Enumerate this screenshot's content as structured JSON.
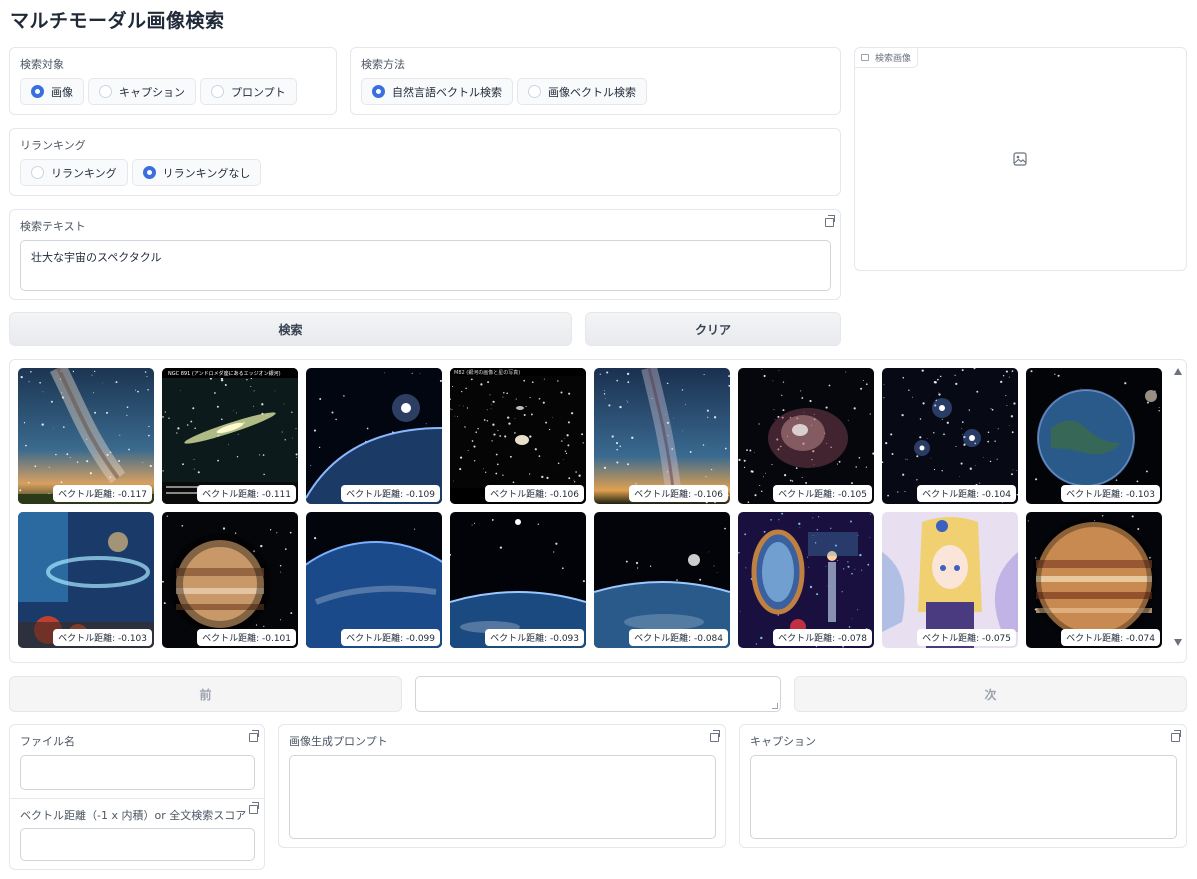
{
  "app": {
    "title": "マルチモーダル画像検索"
  },
  "target": {
    "label": "検索対象",
    "options": [
      {
        "label": "画像",
        "selected": true
      },
      {
        "label": "キャプション",
        "selected": false
      },
      {
        "label": "プロンプト",
        "selected": false
      }
    ]
  },
  "method": {
    "label": "検索方法",
    "options": [
      {
        "label": "自然言語ベクトル検索",
        "selected": true
      },
      {
        "label": "画像ベクトル検索",
        "selected": false
      }
    ]
  },
  "rerank": {
    "label": "リランキング",
    "options": [
      {
        "label": "リランキング",
        "selected": false
      },
      {
        "label": "リランキングなし",
        "selected": true
      }
    ]
  },
  "query": {
    "label": "検索テキスト",
    "value": "壮大な宇宙のスペクタクル"
  },
  "image_input": {
    "label": "検索画像"
  },
  "buttons": {
    "search": "検索",
    "clear": "クリア",
    "prev": "前",
    "next": "次"
  },
  "gallery": {
    "caption_prefix": "ベクトル距離:",
    "items": [
      {
        "score": "-0.117",
        "art": "milkyway"
      },
      {
        "score": "-0.111",
        "art": "galaxy_edge"
      },
      {
        "score": "-0.109",
        "art": "planet_rise"
      },
      {
        "score": "-0.106",
        "art": "starfield"
      },
      {
        "score": "-0.106",
        "art": "milkyway2"
      },
      {
        "score": "-0.105",
        "art": "nebula"
      },
      {
        "score": "-0.104",
        "art": "cluster"
      },
      {
        "score": "-0.103",
        "art": "earth_globe"
      },
      {
        "score": "-0.103",
        "art": "fantasy_book"
      },
      {
        "score": "-0.101",
        "art": "jupiter"
      },
      {
        "score": "-0.099",
        "art": "earth_night"
      },
      {
        "score": "-0.093",
        "art": "earth_limb"
      },
      {
        "score": "-0.084",
        "art": "earth_moon"
      },
      {
        "score": "-0.078",
        "art": "mirror"
      },
      {
        "score": "-0.075",
        "art": "fairy"
      },
      {
        "score": "-0.074",
        "art": "jupiter2"
      }
    ],
    "header_text": {
      "t2": "NGC 891 (アンドロメダ座にあるエッジオン銀河)",
      "t4": "M82 (銀河の画像と星の写真)"
    }
  },
  "fields": {
    "filename": {
      "label": "ファイル名",
      "value": ""
    },
    "distance": {
      "label": "ベクトル距離（-1 x 内積）or 全文検索スコア",
      "value": ""
    },
    "prompt": {
      "label": "画像生成プロンプト",
      "value": ""
    },
    "caption": {
      "label": "キャプション",
      "value": ""
    }
  },
  "colors": {
    "accent": "#3b6fe0",
    "border": "#e5e7eb"
  }
}
